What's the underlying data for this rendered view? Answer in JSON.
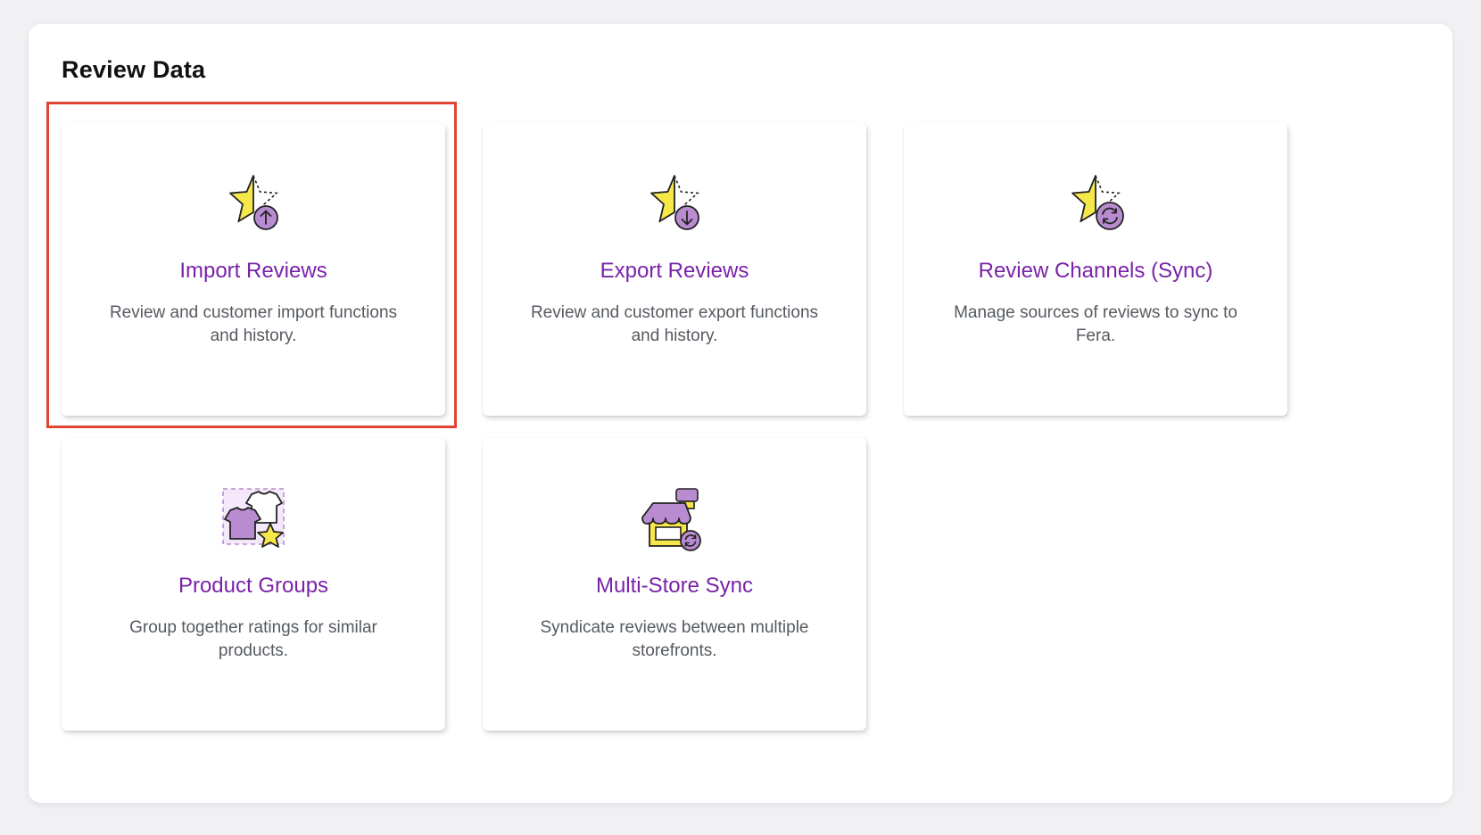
{
  "section": {
    "title": "Review Data"
  },
  "cards": [
    {
      "title": "Import Reviews",
      "description": "Review and customer import functions and history.",
      "icon": "star-import-icon"
    },
    {
      "title": "Export Reviews",
      "description": "Review and customer export functions and history.",
      "icon": "star-export-icon"
    },
    {
      "title": "Review Channels (Sync)",
      "description": "Manage sources of reviews to sync to Fera.",
      "icon": "star-sync-icon"
    },
    {
      "title": "Product Groups",
      "description": "Group together ratings for similar products.",
      "icon": "product-groups-icon"
    },
    {
      "title": "Multi-Store Sync",
      "description": "Syndicate reviews between multiple storefronts.",
      "icon": "multi-store-icon"
    }
  ],
  "colors": {
    "accent": "#7a22a8",
    "star_yellow": "#f7e84a",
    "icon_purple": "#b98bd1",
    "highlight": "#e04433"
  }
}
